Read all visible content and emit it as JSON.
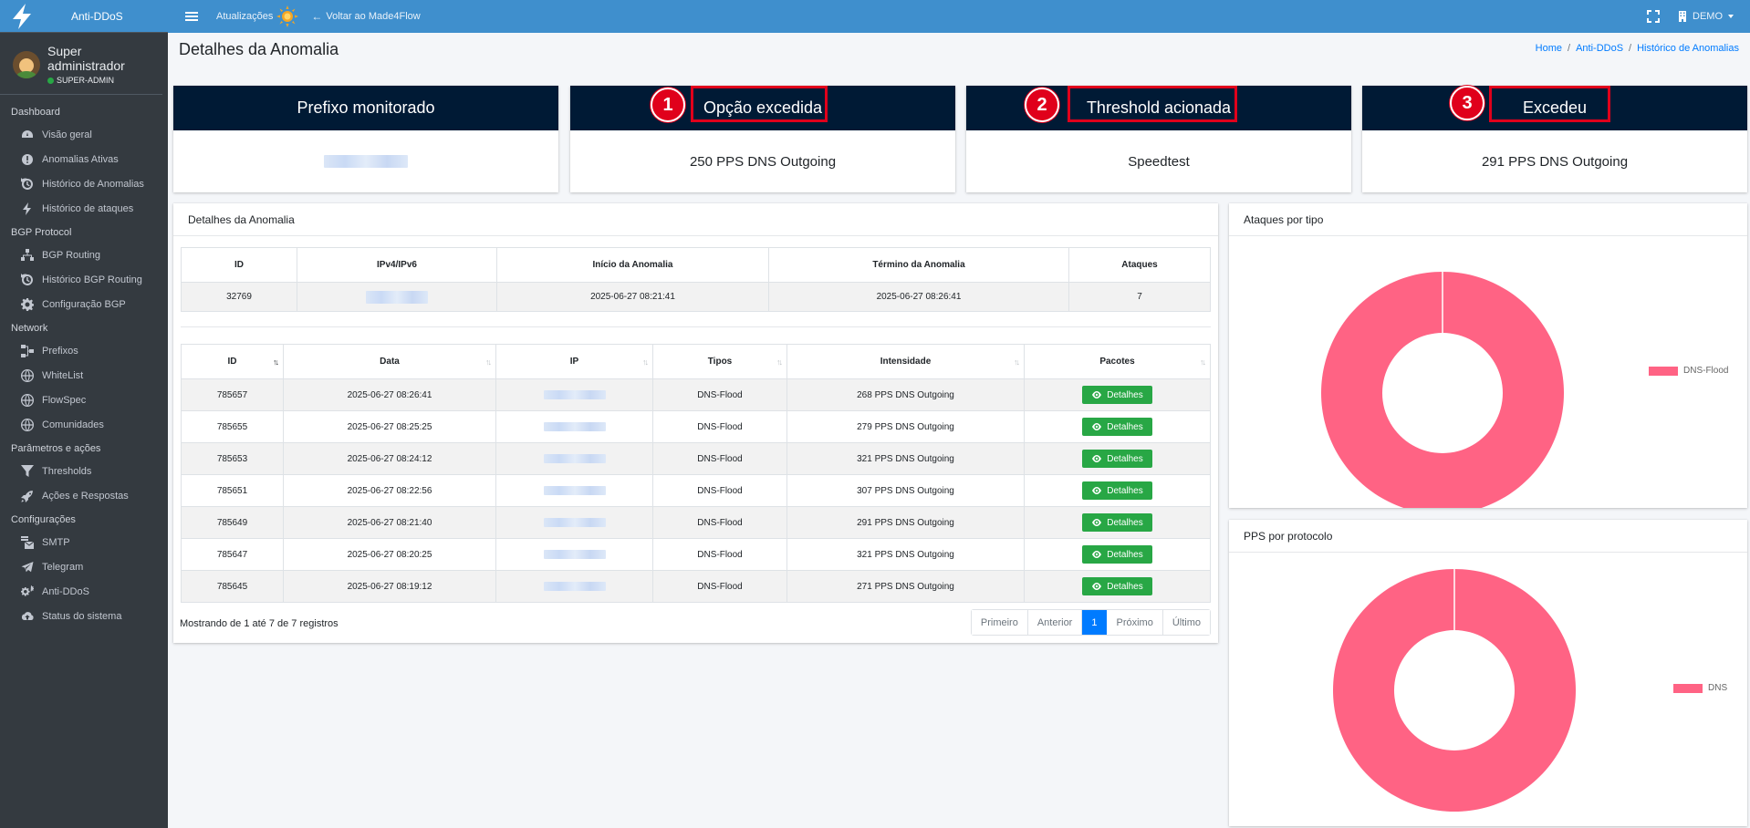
{
  "app": {
    "title": "Anti-DDoS"
  },
  "topbar": {
    "updates_label": "Atualizações",
    "back_label": "Voltar ao Made4Flow",
    "account_label": "DEMO"
  },
  "user": {
    "name": "Super administrador",
    "role": "SUPER-ADMIN"
  },
  "sidebar": {
    "sections": [
      {
        "header": "Dashboard",
        "items": [
          {
            "label": "Visão geral",
            "icon": "dashboard-icon"
          },
          {
            "label": "Anomalias Ativas",
            "icon": "alert-circle-icon"
          },
          {
            "label": "Histórico de Anomalias",
            "icon": "history-icon"
          },
          {
            "label": "Histórico de ataques",
            "icon": "bolt-icon"
          }
        ]
      },
      {
        "header": "BGP Protocol",
        "items": [
          {
            "label": "BGP Routing",
            "icon": "network-icon"
          },
          {
            "label": "Histórico BGP Routing",
            "icon": "history-icon"
          },
          {
            "label": "Configuração BGP",
            "icon": "gear-icon"
          }
        ]
      },
      {
        "header": "Network",
        "items": [
          {
            "label": "Prefixos",
            "icon": "project-diagram-icon"
          },
          {
            "label": "WhiteList",
            "icon": "globe-icon"
          },
          {
            "label": "FlowSpec",
            "icon": "globe-icon"
          },
          {
            "label": "Comunidades",
            "icon": "globe-icon"
          }
        ]
      },
      {
        "header": "Parâmetros e ações",
        "items": [
          {
            "label": "Thresholds",
            "icon": "filter-icon"
          },
          {
            "label": "Ações e Respostas",
            "icon": "rocket-icon"
          }
        ]
      },
      {
        "header": "Configurações",
        "items": [
          {
            "label": "SMTP",
            "icon": "mail-bulk-icon"
          },
          {
            "label": "Telegram",
            "icon": "telegram-icon"
          },
          {
            "label": "Anti-DDoS",
            "icon": "gears-icon"
          },
          {
            "label": "Status do sistema",
            "icon": "cloud-upload-icon"
          }
        ]
      }
    ]
  },
  "page": {
    "title": "Detalhes da Anomalia",
    "breadcrumb": [
      "Home",
      "Anti-DDoS",
      "Histórico de Anomalias"
    ]
  },
  "summary_cards": [
    {
      "title": "Prefixo monitorado",
      "value": "",
      "badge": ""
    },
    {
      "title": "Opção excedida",
      "value": "250 PPS DNS Outgoing",
      "badge": "1"
    },
    {
      "title": "Threshold acionada",
      "value": "Speedtest",
      "badge": "2"
    },
    {
      "title": "Excedeu",
      "value": "291 PPS DNS Outgoing",
      "badge": "3"
    }
  ],
  "anomaly_panel": {
    "title": "Detalhes da Anomalia",
    "summary_headers": [
      "ID",
      "IPv4/IPv6",
      "Início da Anomalia",
      "Término da Anomalia",
      "Ataques"
    ],
    "summary_row": {
      "id": "32769",
      "ip": "",
      "start": "2025-06-27 08:21:41",
      "end": "2025-06-27 08:26:41",
      "attacks": "7"
    },
    "attack_headers": [
      "ID",
      "Data",
      "IP",
      "Tipos",
      "Intensidade",
      "Pacotes"
    ],
    "attack_rows": [
      {
        "id": "785657",
        "date": "2025-06-27 08:26:41",
        "ip": "",
        "type": "DNS-Flood",
        "intensity": "268 PPS DNS Outgoing",
        "action": "Detalhes"
      },
      {
        "id": "785655",
        "date": "2025-06-27 08:25:25",
        "ip": "",
        "type": "DNS-Flood",
        "intensity": "279 PPS DNS Outgoing",
        "action": "Detalhes"
      },
      {
        "id": "785653",
        "date": "2025-06-27 08:24:12",
        "ip": "",
        "type": "DNS-Flood",
        "intensity": "321 PPS DNS Outgoing",
        "action": "Detalhes"
      },
      {
        "id": "785651",
        "date": "2025-06-27 08:22:56",
        "ip": "",
        "type": "DNS-Flood",
        "intensity": "307 PPS DNS Outgoing",
        "action": "Detalhes"
      },
      {
        "id": "785649",
        "date": "2025-06-27 08:21:40",
        "ip": "",
        "type": "DNS-Flood",
        "intensity": "291 PPS DNS Outgoing",
        "action": "Detalhes"
      },
      {
        "id": "785647",
        "date": "2025-06-27 08:20:25",
        "ip": "",
        "type": "DNS-Flood",
        "intensity": "321 PPS DNS Outgoing",
        "action": "Detalhes"
      },
      {
        "id": "785645",
        "date": "2025-06-27 08:19:12",
        "ip": "",
        "type": "DNS-Flood",
        "intensity": "271 PPS DNS Outgoing",
        "action": "Detalhes"
      }
    ],
    "footer_info": "Mostrando de 1 até 7 de 7 registros",
    "pagination": [
      "Primeiro",
      "Anterior",
      "1",
      "Próximo",
      "Último"
    ]
  },
  "charts": {
    "attacks_by_type": {
      "title": "Ataques por tipo",
      "legend": "DNS-Flood",
      "color": "#ff6384"
    },
    "pps_by_protocol": {
      "title": "PPS por protocolo",
      "legend": "DNS",
      "color": "#ff6384"
    }
  }
}
